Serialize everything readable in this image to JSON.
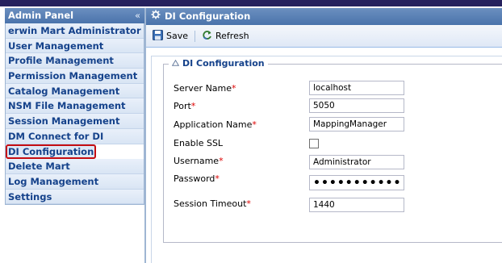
{
  "sidebar": {
    "title": "Admin Panel",
    "collapse_icon": "«",
    "items": [
      {
        "label": "erwin Mart Administrator"
      },
      {
        "label": "User Management"
      },
      {
        "label": "Profile Management"
      },
      {
        "label": "Permission Management"
      },
      {
        "label": "Catalog Management"
      },
      {
        "label": "NSM File Management"
      },
      {
        "label": "Session Management"
      },
      {
        "label": "DM Connect for DI"
      },
      {
        "label": "DI Configuration",
        "active": true
      },
      {
        "label": "Delete Mart"
      },
      {
        "label": "Log Management"
      },
      {
        "label": "Settings"
      }
    ]
  },
  "main": {
    "title": "DI Configuration",
    "toolbar": {
      "save_label": "Save",
      "refresh_label": "Refresh"
    },
    "fieldset": {
      "legend": "DI Configuration",
      "fields": {
        "server_name": {
          "label": "Server Name",
          "required": "*",
          "value": "localhost"
        },
        "port": {
          "label": "Port",
          "required": "*",
          "value": "5050"
        },
        "application_name": {
          "label": "Application Name",
          "required": "*",
          "value": "MappingManager"
        },
        "enable_ssl": {
          "label": "Enable SSL",
          "checked": false
        },
        "username": {
          "label": "Username",
          "required": "*",
          "value": "Administrator"
        },
        "password": {
          "label": "Password",
          "required": "*",
          "value": "•••••••••••••"
        },
        "session_timeout": {
          "label": "Session Timeout",
          "required": "*",
          "value": "1440"
        }
      }
    }
  },
  "colors": {
    "header_blue": "#4a73ab",
    "nav_text": "#15428b",
    "active_border": "#c40d12",
    "required": "#dd0000",
    "top_bar": "#26215e"
  }
}
